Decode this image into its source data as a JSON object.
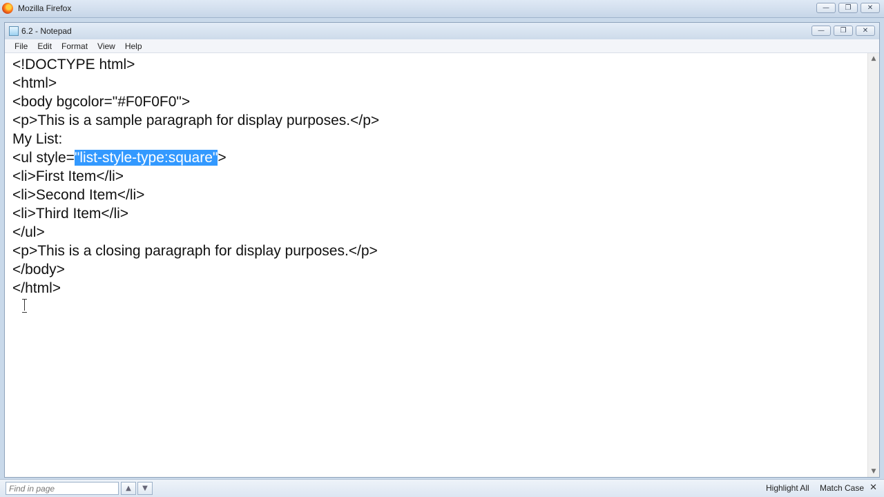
{
  "browser": {
    "title": "Mozilla Firefox",
    "controls": {
      "minimize": "—",
      "restore": "❐",
      "close": "✕"
    }
  },
  "notepad": {
    "title": "6.2 - Notepad",
    "controls": {
      "minimize": "—",
      "restore": "❐",
      "close": "✕"
    },
    "menu": [
      "File",
      "Edit",
      "Format",
      "View",
      "Help"
    ],
    "lines": [
      "<!DOCTYPE html>",
      "<html>",
      "<body bgcolor=\"#F0F0F0\">",
      "<p>This is a sample paragraph for display purposes.</p>",
      "My List:",
      "",
      "<li>First Item</li>",
      "<li>Second Item</li>",
      "<li>Third Item</li>",
      "</ul>",
      "<p>This is a closing paragraph for display purposes.</p>",
      "</body>",
      "</html>"
    ],
    "selected_line": {
      "before": "<ul style=",
      "selection": "\"list-style-type:square\"",
      "after": ">"
    }
  },
  "findbar": {
    "placeholder": "Find in page",
    "prev": "▲",
    "next": "▼",
    "highlight_all": "Highlight All",
    "match_case": "Match Case",
    "close": "✕"
  },
  "colors": {
    "selection": "#3399ff"
  }
}
